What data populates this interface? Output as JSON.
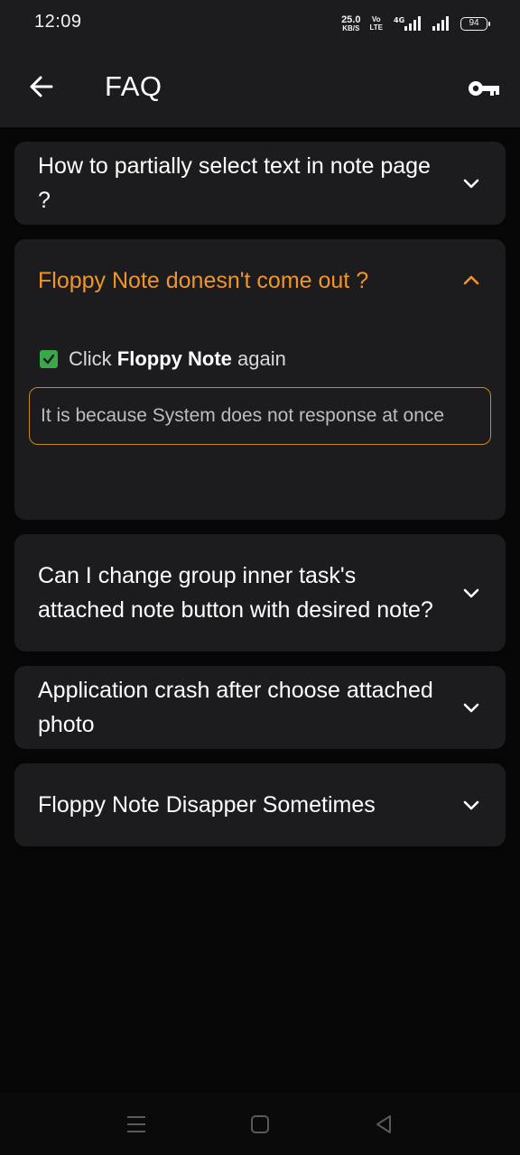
{
  "status_bar": {
    "time": "12:09",
    "net_speed_value": "25.0",
    "net_speed_unit": "KB/S",
    "volte_top": "Vo",
    "volte_bottom": "LTE",
    "network_type": "4G",
    "battery": "94"
  },
  "app_bar": {
    "title": "FAQ",
    "back_icon": "arrow-left-icon",
    "action_icon": "key-icon"
  },
  "faq": [
    {
      "question": "How to partially select text in note page ?",
      "expanded": false
    },
    {
      "question": "Floppy Note donesn't come out ?",
      "expanded": true,
      "answer_prefix": "Click ",
      "answer_bold": "Floppy Note",
      "answer_suffix": " again",
      "note": "It is because System does not response at once"
    },
    {
      "question": "Can I change group inner task's attached note button with desired note?",
      "expanded": false
    },
    {
      "question": "Application crash after choose attached photo",
      "expanded": false
    },
    {
      "question": "Floppy Note Disapper Sometimes",
      "expanded": false
    }
  ],
  "colors": {
    "accent": "#f0952a",
    "card": "#1c1c1e",
    "background": "#060606",
    "note_border": "#c88a1f",
    "check": "#3aa84a"
  }
}
